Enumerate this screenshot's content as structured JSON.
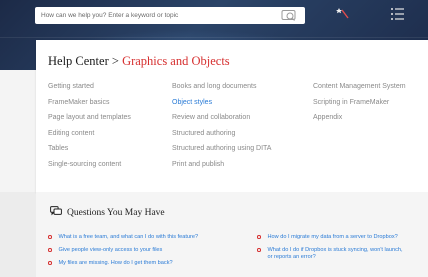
{
  "search": {
    "placeholder": "How can we help you? Enter a keyword or topic"
  },
  "header_icons": [
    "search-icon",
    "magic-wand-icon",
    "menu-list-icon"
  ],
  "breadcrumb": {
    "root": "Help Center",
    "separator": ">",
    "current": "Graphics and Objects"
  },
  "topics": {
    "col1": [
      "Getting started",
      "FrameMaker basics",
      "Page layout and templates",
      "Editing content",
      "Tables",
      "Single-sourcing content"
    ],
    "col2": [
      "Books and long documents",
      "Object styles",
      "Review and collaboration",
      "Structured authoring",
      "Structured authoring using DITA",
      "Print and publish"
    ],
    "col3": [
      "Content Management System",
      "Scripting in FrameMaker",
      "Appendix"
    ],
    "active": "Object styles"
  },
  "questions": {
    "heading": "Questions You May Have",
    "left": [
      "What is a free team, and what can I do with this feature?",
      "Give people view-only access to your files",
      "My files are missing. How do I get them back?"
    ],
    "right": [
      "How do I migrate my data from a server to Dropbox?",
      "What do I do if Dropbox is stuck syncing, won't launch,",
      "or reports an error?"
    ]
  },
  "colors": {
    "accent_red": "#d62f2f",
    "link_blue": "#2a7bd6",
    "hero_navy": "#1c2a47"
  }
}
